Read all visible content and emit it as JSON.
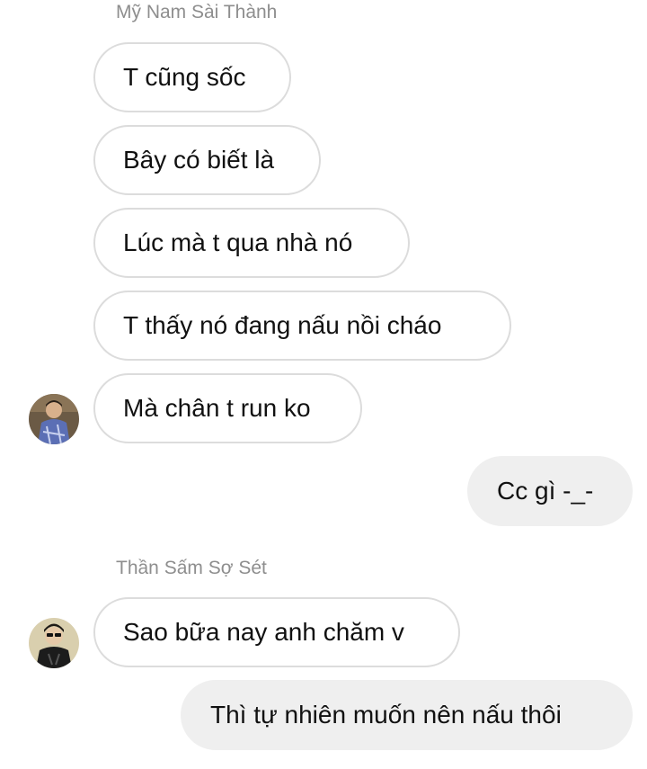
{
  "groups": [
    {
      "sender": "Mỹ Nam Sài Thành",
      "avatar_icon": "person-photo-avatar",
      "messages": [
        "T cũng sốc",
        "Bây có biết là",
        "Lúc mà t qua nhà nó",
        "T thấy nó đang nấu nồi cháo",
        "Mà chân t run ko"
      ]
    },
    {
      "sender": "Thần Sấm Sợ Sét",
      "avatar_icon": "person-photo-avatar",
      "messages": [
        "Sao bữa nay anh chăm v"
      ]
    }
  ],
  "outgoing": [
    "Cc gì -_-",
    "Thì tự nhiên muốn nên nấu thôi"
  ],
  "colors": {
    "incoming_bg": "#ffffff",
    "incoming_border": "#dcdcdc",
    "outgoing_bg": "#efefef",
    "sender_text": "#8e8e8e"
  }
}
